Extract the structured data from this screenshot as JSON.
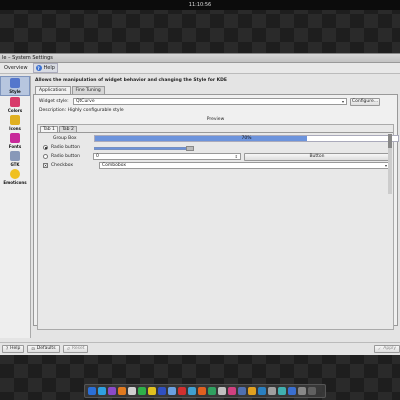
{
  "clock": "11:10:56",
  "window": {
    "title": "le – System Settings",
    "nav": {
      "overview": "Overview",
      "help": "Help"
    }
  },
  "sidebar": {
    "items": [
      {
        "label": "Style",
        "icon": "style-icon",
        "color": "#5577cc"
      },
      {
        "label": "Colors",
        "icon": "colors-icon",
        "color": "#d83a6a"
      },
      {
        "label": "Icons",
        "icon": "icons-icon",
        "color": "#e0b020"
      },
      {
        "label": "Fonts",
        "icon": "fonts-icon",
        "color": "#c82a9a"
      },
      {
        "label": "GTK",
        "icon": "gtk-icon",
        "color": "#8898b8"
      },
      {
        "label": "Emoticons",
        "icon": "emoticons-icon",
        "color": "#f0c020"
      }
    ]
  },
  "main": {
    "heading": "Allows the manipulation of widget behavior and changing the Style for KDE",
    "tabs": [
      "Applications",
      "Fine Tuning"
    ],
    "widget_style_label": "Widget style:",
    "widget_style_value": "QtCurve",
    "configure_button": "Configure...",
    "description": "Description: Highly configurable style",
    "preview_label": "Preview",
    "preview": {
      "tabs": [
        "Tab 1",
        "Tab 2"
      ],
      "group_box": "Group Box",
      "progress_text": "70%",
      "progress_value": 0.7,
      "radio1": "Radio button",
      "radio2": "Radio button",
      "spin_value": "0",
      "button": "Button",
      "checkbox": "Checkbox",
      "checkbox_mark": "✕",
      "combobox": "Combobox",
      "slider_value": 0.32
    }
  },
  "footer": {
    "help": "Help",
    "defaults": "Defaults",
    "reset": "Reset",
    "apply": "Apply"
  },
  "dock": {
    "icons": [
      "#2b6fd6",
      "#2fa0e0",
      "#8a4ac8",
      "#e07a20",
      "#d0d0d0",
      "#2fb04a",
      "#e0c020",
      "#3050c0",
      "#6aa0e0",
      "#d03030",
      "#40a0d0",
      "#e06020",
      "#30a060",
      "#c0c0c0",
      "#d04080",
      "#5070b0",
      "#e0a020",
      "#2a80c0",
      "#a0a0a0",
      "#40b0b0",
      "#3a6fd0",
      "#888888",
      "#606060"
    ]
  }
}
